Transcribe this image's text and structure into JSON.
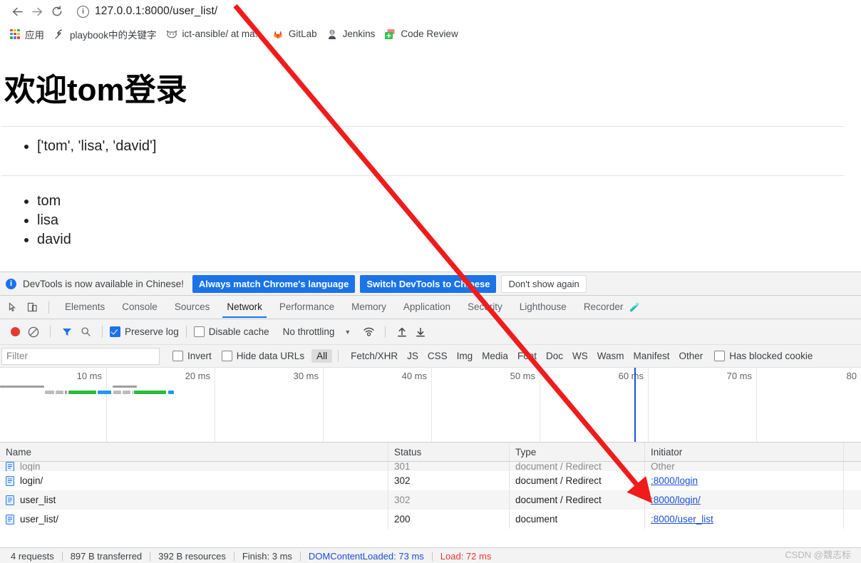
{
  "browser": {
    "nav": {
      "back": "←",
      "forward": "→",
      "reload": "⟳"
    },
    "omnibox": {
      "info_icon_glyph": "i",
      "url": "127.0.0.1:8000/user_list/",
      "url_host": "127.0.0.1:8000",
      "url_path": "/user_list/"
    },
    "bookmarks": [
      {
        "label": "应用",
        "icon": "apps-grid-icon"
      },
      {
        "label": "playbook中的关键字",
        "icon": "feather-pen-icon"
      },
      {
        "label": "ict-ansible/ at ma...",
        "icon": "gitlab-fox-icon"
      },
      {
        "label": "GitLab",
        "icon": "gitlab-tanuki-icon"
      },
      {
        "label": "Jenkins",
        "icon": "jenkins-butler-icon"
      },
      {
        "label": "Code Review",
        "icon": "gerrit-code-review-icon"
      }
    ]
  },
  "page": {
    "heading": "欢迎tom登录",
    "list_one": [
      "['tom', 'lisa', 'david']"
    ],
    "list_two": [
      "tom",
      "lisa",
      "david"
    ]
  },
  "devtools": {
    "notice": {
      "text": "DevTools is now available in Chinese!",
      "info_icon_glyph": "i",
      "buttons": [
        {
          "label": "Always match Chrome's language",
          "style": "primary"
        },
        {
          "label": "Switch DevTools to Chinese",
          "style": "primary"
        },
        {
          "label": "Don't show again",
          "style": "plain"
        }
      ]
    },
    "tabs": [
      {
        "label": "Elements",
        "active": false
      },
      {
        "label": "Console",
        "active": false
      },
      {
        "label": "Sources",
        "active": false
      },
      {
        "label": "Network",
        "active": true
      },
      {
        "label": "Performance",
        "active": false
      },
      {
        "label": "Memory",
        "active": false
      },
      {
        "label": "Application",
        "active": false
      },
      {
        "label": "Security",
        "active": false
      },
      {
        "label": "Lighthouse",
        "active": false
      },
      {
        "label": "Recorder",
        "active": false,
        "suffix_icon": "flask-icon"
      }
    ],
    "controls": {
      "record_label": "record-button",
      "clear_label": "clear-button",
      "filter_toggle_label": "filter-toggle",
      "search_label": "search-button",
      "preserve_log": {
        "label": "Preserve log",
        "checked": true
      },
      "disable_cache": {
        "label": "Disable cache",
        "checked": false
      },
      "throttling": "No throttling",
      "import_label": "import-har",
      "export_label": "export-har"
    },
    "filter_bar": {
      "filter_placeholder": "Filter",
      "filter_value": "",
      "invert": {
        "label": "Invert",
        "checked": false
      },
      "hide_data_urls": {
        "label": "Hide data URLs",
        "checked": false
      },
      "types": [
        "All",
        "Fetch/XHR",
        "JS",
        "CSS",
        "Img",
        "Media",
        "Font",
        "Doc",
        "WS",
        "Wasm",
        "Manifest",
        "Other"
      ],
      "selected_type": "All",
      "has_blocked_cookies": {
        "label": "Has blocked cookie",
        "checked": false
      }
    },
    "overview": {
      "ticks": [
        "10 ms",
        "20 ms",
        "30 ms",
        "40 ms",
        "50 ms",
        "60 ms",
        "70 ms",
        "80"
      ],
      "marker_dom_content_loaded_ms": 73
    },
    "table": {
      "columns": [
        "Name",
        "Status",
        "Type",
        "Initiator"
      ],
      "rows": [
        {
          "name": "login",
          "status": "301",
          "type": "document / Redirect",
          "initiator": "Other",
          "clipped": true,
          "muted": true
        },
        {
          "name": "login/",
          "status": "302",
          "type": "document / Redirect",
          "initiator": ":8000/login",
          "initiator_link": true
        },
        {
          "name": "user_list",
          "status": "302",
          "type": "document / Redirect",
          "initiator": ":8000/login/",
          "initiator_link": true,
          "muted": true
        },
        {
          "name": "user_list/",
          "status": "200",
          "type": "document",
          "initiator": ":8000/user_list",
          "initiator_link": true
        }
      ]
    },
    "status_bar": {
      "requests": "4 requests",
      "transferred": "897 B transferred",
      "resources": "392 B resources",
      "finish": "Finish: 3 ms",
      "dom_content_loaded": "DOMContentLoaded: 73 ms",
      "load": "Load: 72 ms"
    }
  },
  "annotation": {
    "type": "red-arrow",
    "from": [
      330,
      10
    ],
    "to": [
      905,
      692
    ],
    "color": "#f01b1b"
  },
  "watermark": "CSDN @魏志标",
  "colors": {
    "accent_blue": "#1a73e8",
    "link_blue": "#1a4fd8",
    "record_red": "#e53935",
    "annotation_red": "#f01b1b",
    "chrome_bg": "#f3f3f3"
  }
}
